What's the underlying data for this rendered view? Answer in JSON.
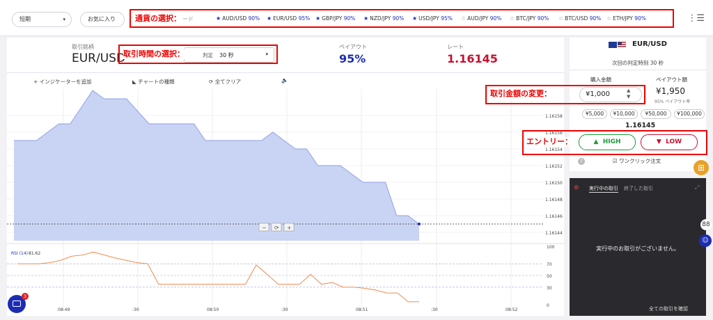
{
  "topbar": {
    "period_select": "短期",
    "favorites_select": "お気に入り",
    "pairs": [
      {
        "name": "AUD/USD",
        "pct": "90%",
        "starred": true,
        "active": false
      },
      {
        "name": "EUR/USD",
        "pct": "95%",
        "starred": true,
        "active": true
      },
      {
        "name": "GBP/JPY",
        "pct": "90%",
        "starred": true,
        "active": false
      },
      {
        "name": "NZD/JPY",
        "pct": "90%",
        "starred": true,
        "active": false
      },
      {
        "name": "USD/JPY",
        "pct": "95%",
        "starred": true,
        "active": false
      },
      {
        "name": "AUD/JPY",
        "pct": "90%",
        "starred": false,
        "active": false
      },
      {
        "name": "BTC/JPY",
        "pct": "90%",
        "starred": false,
        "active": false
      },
      {
        "name": "BTC/USD",
        "pct": "90%",
        "starred": false,
        "active": false
      },
      {
        "name": "ETH/JPY",
        "pct": "90%",
        "starred": false,
        "active": false
      }
    ],
    "menu_icon": "hamburger-menu-icon"
  },
  "header": {
    "symbol_label": "取引銘柄",
    "symbol": "EUR/USD",
    "expiry_label": "判定",
    "expiry_value": "30 秒",
    "payout_label": "ペイアウト",
    "payout_value": "95%",
    "rate_label": "レート",
    "rate_value": "1.16145"
  },
  "chart_toolbar": {
    "add_indicator": "+ インジケーターを追加",
    "chart_type": "チャートの種類",
    "clear_all": "全てクリア"
  },
  "chart_data": {
    "type": "area",
    "y_ticks": [
      "1.16158",
      "1.16156",
      "1.16154",
      "1.16152",
      "1.16150",
      "1.16148",
      "1.16146",
      "1.16144"
    ],
    "ylim": [
      1.16143,
      1.16161
    ],
    "x": [
      0,
      2,
      3,
      4,
      5,
      6,
      7,
      8,
      10,
      12,
      13,
      14,
      15,
      16,
      17,
      18,
      19,
      20,
      21,
      22,
      23,
      24,
      25,
      26,
      27,
      28,
      29,
      30,
      31,
      32,
      33,
      34,
      35,
      36
    ],
    "y": [
      1.16155,
      1.16155,
      1.16156,
      1.16157,
      1.16157,
      1.16159,
      1.16161,
      1.1616,
      1.1616,
      1.16157,
      1.16157,
      1.16157,
      1.16157,
      1.16157,
      1.16155,
      1.16155,
      1.16155,
      1.16155,
      1.16155,
      1.16155,
      1.16156,
      1.16155,
      1.16154,
      1.16154,
      1.16152,
      1.16152,
      1.16152,
      1.16151,
      1.1615,
      1.1615,
      1.1615,
      1.16146,
      1.16146,
      1.16145
    ],
    "x_ticks": [
      "08:49",
      ":30",
      "08:50",
      ":30",
      "08:51",
      ":30",
      "08:52"
    ],
    "current_rate": "1.16145"
  },
  "rsi": {
    "label": "RSI (14)",
    "value": "81.62",
    "y_ticks": [
      "100",
      "70",
      "50",
      "30",
      "0"
    ],
    "values": [
      70,
      70,
      70,
      72,
      76,
      83,
      85,
      90,
      85,
      80,
      76,
      72,
      70,
      35,
      35,
      35,
      35,
      35,
      35,
      35,
      35,
      35,
      68,
      52,
      35,
      35,
      35,
      52,
      35,
      38,
      30,
      30,
      28,
      25,
      20,
      20,
      5,
      5
    ]
  },
  "order": {
    "flag": "EUR/USD",
    "next_judgement": "次回の判定時刻 30 秒",
    "amount_label": "購入金額",
    "payout_label": "ペイアウト額",
    "amount_value": "¥1,000",
    "payout_amount": "¥1,950",
    "payout_rate_note": "95% ペイアウト率",
    "presets": [
      "¥5,000",
      "¥10,000",
      "¥50,000",
      "¥100,000"
    ],
    "rate": "1.16145",
    "high_label": "HIGH",
    "low_label": "LOW",
    "oneclick_label": "ワンクリック注文"
  },
  "trades": {
    "tab_active": "実行中の取引",
    "tab_closed": "終了した取引",
    "empty_message": "実行中のお取引がございません。",
    "confirm_all": "全ての取引を確認"
  },
  "annotations": {
    "currency": "通貨の選択：",
    "time": "取引時間の選択：",
    "amount": "取引金額の変更：",
    "entry": "エントリー："
  },
  "chat_badge": "3",
  "colors": {
    "brand_blue": "#1c2db3",
    "rate_red": "#c8102e",
    "chart_fill": "#c9d3f3",
    "chart_line": "#8ea2e6",
    "rsi_line": "#ef7d38",
    "high_green": "#1d9a3a",
    "annotation_red": "#e00000"
  }
}
